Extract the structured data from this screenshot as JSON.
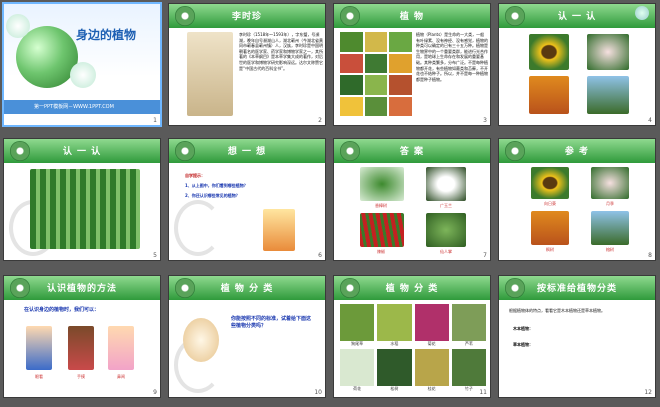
{
  "slides": [
    {
      "num": "1",
      "title": "身边的植物",
      "footer": "第一PPT模板网－WWW.1PPT.COM"
    },
    {
      "num": "2",
      "title": "李时珍",
      "text": "李时珍（1518年～1593年），字东璧，号濒湖，晚年自号濒湖山人，湖北蕲州（今湖北省黄冈市蕲春县蕲州镇）人，汉族，李时珍是中国明朝著名的医学家、药学家和博物学家之一，其所著的《本草纲目》是本草学集大成的著作，对后世的医学和博物学研究影响深远。达尔文称赞它是“中国古代的百科全书”。"
    },
    {
      "num": "3",
      "title": "植 物",
      "text": "植物（Plants）是生命的一大类，一般有叶绿素、没有神经、没有感觉，植物的种类可以确定的已有三十五万种。植物是生物界中的一个重要类群，能进行光合作用，是地球上生命存在和发展的重要基础。其种类繁多，分布广泛。不是每种植物都开花，有些植物如蕨类和苔藓，不开花也不结种子。所以，并不是每一种植物都是种子植物。"
    },
    {
      "num": "4",
      "title": "认 一 认"
    },
    {
      "num": "5",
      "title": "认 一 认"
    },
    {
      "num": "6",
      "title": "想 一 想",
      "q_head": "自学提示：",
      "q1": "1、从上图中，你们看到哪些植物？",
      "q2": "2、你还认识哪些常见的植物？"
    },
    {
      "num": "7",
      "title": "答 案",
      "labels": [
        "香樟树",
        "广玉兰",
        "辣椒",
        "仙人掌"
      ]
    },
    {
      "num": "8",
      "title": "参 考",
      "labels": [
        "向日葵",
        "月季",
        "枫树",
        "榕树"
      ]
    },
    {
      "num": "9",
      "title": "认识植物的方法",
      "line": "在认识身边的植物时，我们可以：",
      "kids": [
        "眼看",
        "手摸",
        "鼻闻"
      ]
    },
    {
      "num": "10",
      "title": "植 物 分 类",
      "bubble": "你能按照不同的标准，试着给下面这些植物分类吗？"
    },
    {
      "num": "11",
      "title": "植 物 分 类",
      "labels": [
        "狗尾草",
        "水稻",
        "菊花",
        "芦苇",
        "荷花",
        "松树",
        "桂花",
        "竹子"
      ]
    },
    {
      "num": "12",
      "title": "按标准给植物分类",
      "line": "根据植物体的特点，看看它是木本植物还是草本植物。",
      "a": "木本植物：",
      "b": "草本植物："
    }
  ],
  "colors": {
    "band": "#2f9a3b",
    "accent": "#1b39b0",
    "label": "#cc3333"
  }
}
